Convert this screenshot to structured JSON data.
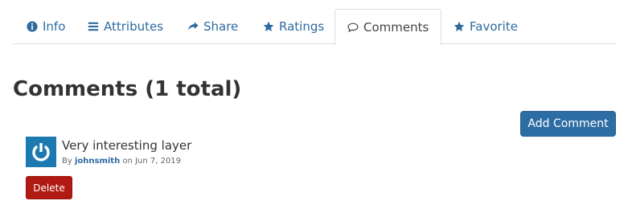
{
  "tabs": [
    {
      "label": "Info",
      "icon": "info-circle-icon"
    },
    {
      "label": "Attributes",
      "icon": "list-icon"
    },
    {
      "label": "Share",
      "icon": "share-icon"
    },
    {
      "label": "Ratings",
      "icon": "star-icon"
    },
    {
      "label": "Comments",
      "icon": "comment-icon",
      "active": true
    },
    {
      "label": "Favorite",
      "icon": "star-icon"
    }
  ],
  "comments_section": {
    "title": "Comments (1 total)",
    "add_button": "Add Comment"
  },
  "comments": [
    {
      "text": "Very interesting layer",
      "by_prefix": "By",
      "author": "johnsmith",
      "date_prefix": "on",
      "date": "Jun 7, 2019",
      "avatar_icon": "power-icon",
      "delete_label": "Delete"
    }
  ],
  "colors": {
    "link": "#2c6aa0",
    "primary": "#2e6da4",
    "danger": "#b01a12",
    "avatar": "#1d7ab0"
  }
}
